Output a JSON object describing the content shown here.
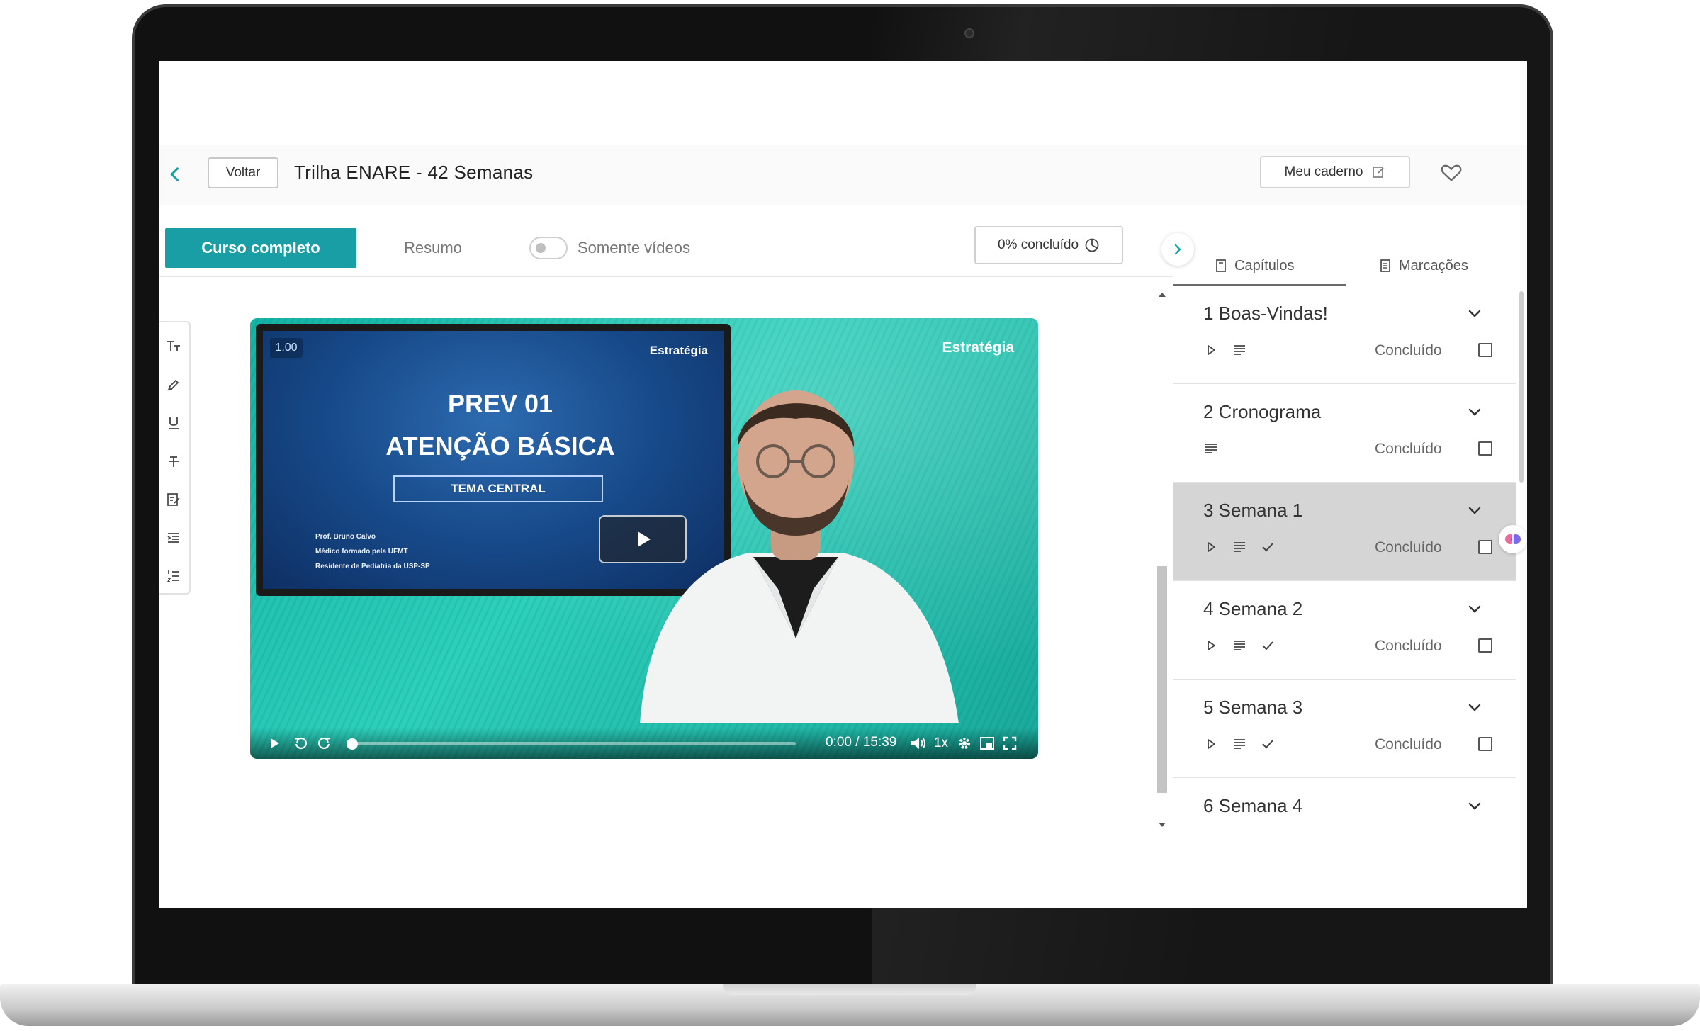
{
  "header": {
    "back_label": "Voltar",
    "title": "Trilha ENARE - 42 Semanas",
    "notebook_label": "Meu caderno"
  },
  "tabs": {
    "full_course": "Curso completo",
    "summary": "Resumo",
    "videos_only": "Somente vídeos",
    "videos_only_enabled": false,
    "progress_label": "0% concluído",
    "progress_percent": 0
  },
  "video": {
    "speed_badge": "1.00",
    "brand": "Estratégia",
    "slide_title_line1": "PREV 01",
    "slide_title_line2": "ATENÇÃO BÁSICA",
    "slide_subtitle": "TEMA CENTRAL",
    "slide_credits": [
      "Prof. Bruno Calvo",
      "Médico formado pela UFMT",
      "Residente de Pediatria da USP-SP"
    ],
    "current_time": "0:00",
    "time_separator": "/",
    "duration": "15:39",
    "playback_rate": "1x",
    "played_fraction": 0
  },
  "panel": {
    "tab_chapters": "Capítulos",
    "tab_bookmarks": "Marcações",
    "chapters": [
      {
        "title": "1 Boas-Vindas!",
        "status": "Concluído",
        "icons": [
          "play-icon",
          "text-icon"
        ]
      },
      {
        "title": "2 Cronograma",
        "status": "Concluído",
        "icons": [
          "text-icon"
        ]
      },
      {
        "title": "3 Semana 1",
        "status": "Concluído",
        "icons": [
          "play-icon",
          "text-icon",
          "check-icon"
        ]
      },
      {
        "title": "4 Semana 2",
        "status": "Concluído",
        "icons": [
          "play-icon",
          "text-icon",
          "check-icon"
        ]
      },
      {
        "title": "5 Semana 3",
        "status": "Concluído",
        "icons": [
          "play-icon",
          "text-icon",
          "check-icon"
        ]
      },
      {
        "title": "6 Semana 4",
        "status": "",
        "icons": []
      }
    ]
  },
  "colors": {
    "accent": "#1a9ea5",
    "active_chapter_bg": "#d5d5d5"
  }
}
